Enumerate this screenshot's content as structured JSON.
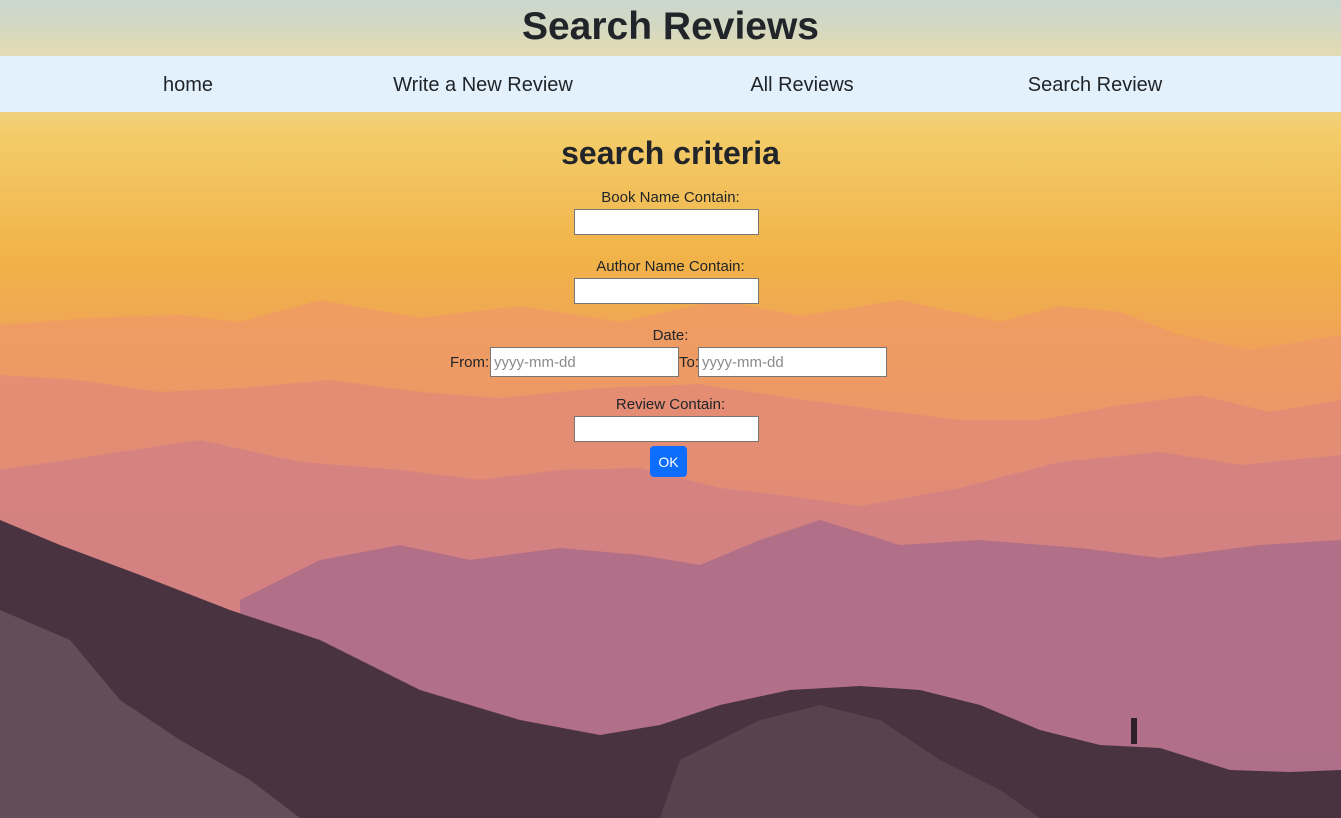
{
  "header": {
    "title": "Search Reviews"
  },
  "nav": {
    "items": [
      {
        "label": "home"
      },
      {
        "label": "Write a New Review"
      },
      {
        "label": "All Reviews"
      },
      {
        "label": "Search Review"
      }
    ]
  },
  "form": {
    "heading": "search criteria",
    "book_name": {
      "label": "Book Name Contain:",
      "value": ""
    },
    "author_name": {
      "label": "Author Name Contain:",
      "value": ""
    },
    "date": {
      "label": "Date:",
      "from_label": "From:",
      "from_placeholder": "yyyy-mm-dd",
      "to_label": "To:",
      "to_placeholder": "yyyy-mm-dd"
    },
    "review": {
      "label": "Review Contain:",
      "value": ""
    },
    "submit_label": "OK"
  },
  "colors": {
    "navbar_bg": "#e2f1fb",
    "button_primary": "#0d6efd",
    "text": "#212529"
  }
}
